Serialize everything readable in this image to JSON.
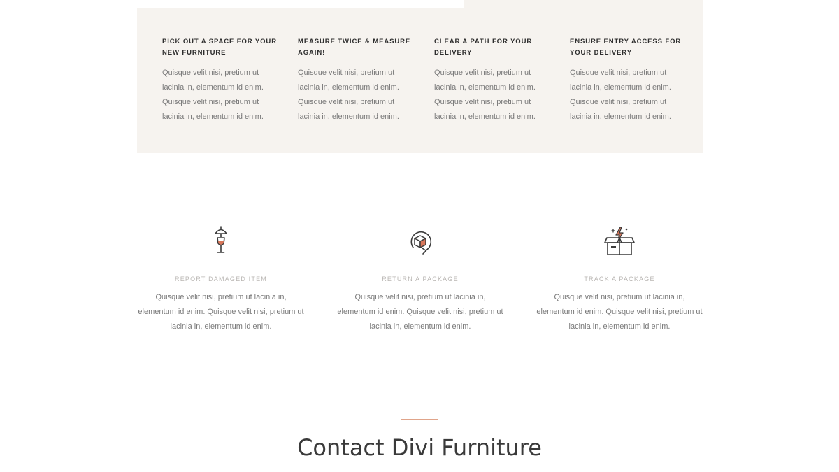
{
  "tips": [
    {
      "title": "Pick out a space for your new furniture",
      "body": "Quisque velit nisi, pretium ut lacinia in, elementum id enim. Quisque velit nisi, pretium ut lacinia in, elementum id enim."
    },
    {
      "title": "Measure twice & measure again!",
      "body": "Quisque velit nisi, pretium ut lacinia in, elementum id enim. Quisque velit nisi, pretium ut lacinia in, elementum id enim."
    },
    {
      "title": "Clear a path for your delivery",
      "body": "Quisque velit nisi, pretium ut lacinia in, elementum id enim. Quisque velit nisi, pretium ut lacinia in, elementum id enim."
    },
    {
      "title": "Ensure entry access for your delivery",
      "body": "Quisque velit nisi, pretium ut lacinia in, elementum id enim. Quisque velit nisi, pretium ut lacinia in, elementum id enim."
    }
  ],
  "services": [
    {
      "icon": "broken-glass-icon",
      "title": "Report Damaged Item",
      "body": "Quisque velit nisi, pretium ut lacinia in, elementum id enim. Quisque velit nisi, pretium ut lacinia in, elementum id enim."
    },
    {
      "icon": "return-package-icon",
      "title": "Return a Package",
      "body": "Quisque velit nisi, pretium ut lacinia in, elementum id enim. Quisque velit nisi, pretium ut lacinia in, elementum id enim."
    },
    {
      "icon": "open-box-icon",
      "title": "Track a Package",
      "body": "Quisque velit nisi, pretium ut lacinia in, elementum id enim. Quisque velit nisi, pretium ut lacinia in, elementum id enim."
    }
  ],
  "contact": {
    "heading": "Contact Divi Furniture"
  },
  "colors": {
    "panel_bg": "#f6f3ef",
    "accent": "#e0a48a",
    "icon_stroke": "#3b3b3b"
  }
}
